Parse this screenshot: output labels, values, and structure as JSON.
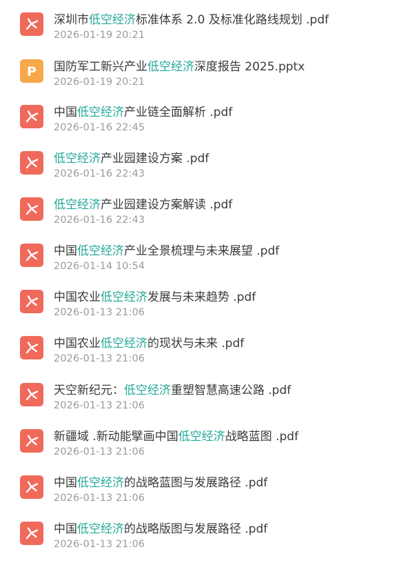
{
  "files": [
    {
      "pre": "深圳市",
      "kw": "低空经济",
      "post": "标准体系 2.0 及标准化路线规划 .pdf",
      "date": "2026-01-19 20:21",
      "icon": "pdf-icon",
      "icon_color": "#f06a5b"
    },
    {
      "pre": "国防军工新兴产业",
      "kw": "低空经济",
      "post": "深度报告 2025.pptx",
      "date": "2026-01-19 20:21",
      "icon": "pptx-icon",
      "icon_color": "#f5a94a"
    },
    {
      "pre": "中国",
      "kw": "低空经济",
      "post": "产业链全面解析 .pdf",
      "date": "2026-01-16 22:45",
      "icon": "pdf-icon",
      "icon_color": "#f06a5b"
    },
    {
      "pre": "",
      "kw": "低空经济",
      "post": "产业园建设方案 .pdf",
      "date": "2026-01-16 22:43",
      "icon": "pdf-icon",
      "icon_color": "#f06a5b"
    },
    {
      "pre": "",
      "kw": "低空经济",
      "post": "产业园建设方案解读 .pdf",
      "date": "2026-01-16 22:43",
      "icon": "pdf-icon",
      "icon_color": "#f06a5b"
    },
    {
      "pre": "中国",
      "kw": "低空经济",
      "post": "产业全景梳理与未来展望 .pdf",
      "date": "2026-01-14 10:54",
      "icon": "pdf-icon",
      "icon_color": "#f06a5b"
    },
    {
      "pre": "中国农业",
      "kw": "低空经济",
      "post": "发展与未来趋势 .pdf",
      "date": "2026-01-13 21:06",
      "icon": "pdf-icon",
      "icon_color": "#f06a5b"
    },
    {
      "pre": "中国农业",
      "kw": "低空经济",
      "post": "的现状与未来 .pdf",
      "date": "2026-01-13 21:06",
      "icon": "pdf-icon",
      "icon_color": "#f06a5b"
    },
    {
      "pre": "天空新纪元：",
      "kw": "低空经济",
      "post": "重塑智慧高速公路 .pdf",
      "date": "2026-01-13 21:06",
      "icon": "pdf-icon",
      "icon_color": "#f06a5b"
    },
    {
      "pre": "新疆域 .新动能擘画中国",
      "kw": "低空经济",
      "post": "战略蓝图 .pdf",
      "date": "2026-01-13 21:06",
      "icon": "pdf-icon",
      "icon_color": "#f06a5b"
    },
    {
      "pre": "中国",
      "kw": "低空经济",
      "post": "的战略蓝图与发展路径 .pdf",
      "date": "2026-01-13 21:06",
      "icon": "pdf-icon",
      "icon_color": "#f06a5b"
    },
    {
      "pre": "中国",
      "kw": "低空经济",
      "post": "的战略版图与发展路径 .pdf",
      "date": "2026-01-13 21:06",
      "icon": "pdf-icon",
      "icon_color": "#f06a5b"
    }
  ]
}
